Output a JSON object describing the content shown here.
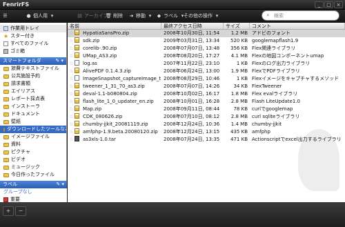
{
  "window": {
    "title": "FenrirFS"
  },
  "toolbar": {
    "profile_label": "個人用",
    "archive_label": "アーカイブ",
    "delete_label": "削除",
    "move_label": "移動",
    "label_label": "ラベル",
    "other_label": "その他の操作",
    "search_placeholder": "検索"
  },
  "sidebar": {
    "top_items": [
      {
        "label": "作業用トレイ",
        "icon": "tray-icon"
      },
      {
        "label": "スター付き",
        "icon": "star-icon"
      },
      {
        "label": "すべてのファイル",
        "icon": "all-files-icon"
      },
      {
        "label": "ゴミ箱",
        "icon": "trash-icon"
      }
    ],
    "smart_header": "スマートフォルダ",
    "smart_items": [
      "旅費テキストファイル",
      "公共施設予約",
      "請求書類",
      "エイリアス",
      "レポート採点表",
      "インストーラ",
      "ドキュメント",
      "壁紙",
      "ダウンロードしたツールなど",
      "イメージファイル",
      "資料",
      "ピクチャ",
      "ビデオ",
      "ミュージック",
      "今日作ったファイル"
    ],
    "label_header": "ラベル",
    "label_items": [
      {
        "label": "グループなし",
        "color": "#3b6fd0"
      },
      {
        "label": "重要",
        "color": "#d23a3a"
      }
    ]
  },
  "list": {
    "headers": [
      "名前",
      "最終アクセス日時",
      "サイズ",
      "コメント"
    ],
    "rows": [
      {
        "name": "HypatiaSansPro.zip",
        "date": "2008年10月30日, 11:54",
        "size": "1.2 MB",
        "comment": "アドビのフォント",
        "type": "zip"
      },
      {
        "name": "sdk.zip",
        "date": "2009年03月31日, 13:34",
        "size": "520 KB",
        "comment": "googlemapflash1.9",
        "type": "zip"
      },
      {
        "name": "corelib-.90.zip",
        "date": "2008年07月07日, 13:48",
        "size": "356 KB",
        "comment": "Flex関連ライブラリ",
        "type": "zip"
      },
      {
        "name": "UMap_AS3.zip",
        "date": "2008年08月20日, 17:27",
        "size": "4.1 MB",
        "comment": "Flexの地図コンポーネントumap",
        "type": "zip"
      },
      {
        "name": "log.as",
        "date": "2007年11月22日, 23:10",
        "size": "1 KB",
        "comment": "Flexのログ出力ライブラリ",
        "type": "txt"
      },
      {
        "name": "AlivePDF 0.1.4.3.zip",
        "date": "2008年06月24日, 13:00",
        "size": "1.9 MB",
        "comment": "FlexでPDFライブラリ",
        "type": "zip"
      },
      {
        "name": "ImageSnapshot_captureImage_t...",
        "date": "2008年08月29日, 10:46",
        "size": "1 KB",
        "comment": "Flexイメージをキャプチャするメソッド",
        "type": "txt"
      },
      {
        "name": "tweener_1_31_70_as3.zip",
        "date": "2008年07月07日, 14:26",
        "size": "34 KB",
        "comment": "FlexTweener",
        "type": "zip"
      },
      {
        "name": "deval-1.1-b080804.zip",
        "date": "2008年10月02日, 16:17",
        "size": "1.8 MB",
        "comment": "Flex evalライブラリ",
        "type": "zip"
      },
      {
        "name": "flash_lite_1_0_updater_en.zip",
        "date": "2008年10月01日, 16:28",
        "size": "2.8 MB",
        "comment": "Flash LiteUpdate1.0",
        "type": "zip"
      },
      {
        "name": "Map.zip",
        "date": "2008年09月11日, 08:44",
        "size": "78 KB",
        "comment": "curlでgooglemap",
        "type": "zip"
      },
      {
        "name": "CDK_080626.zip",
        "date": "2008年07月10日, 08:12",
        "size": "2.8 MB",
        "comment": "curl sqliteライブラリ",
        "type": "zip"
      },
      {
        "name": "chumby-jjkit_20081119.zip",
        "date": "2008年12月24日, 10:36",
        "size": "1.4 MB",
        "comment": "chumby-jjkit",
        "type": "zip"
      },
      {
        "name": "amfphp-1.9.beta.20080120.zip",
        "date": "2008年12月24日, 13:15",
        "size": "435 KB",
        "comment": "amfphp",
        "type": "zip"
      },
      {
        "name": "as3xls-1.0.tar",
        "date": "2008年07月24日, 13:35",
        "size": "471 KB",
        "comment": "Actionscriptでexcel出力するライブラリ",
        "type": "gz"
      }
    ]
  },
  "statusbar": {
    "add_label": "+",
    "remove_label": "−"
  }
}
